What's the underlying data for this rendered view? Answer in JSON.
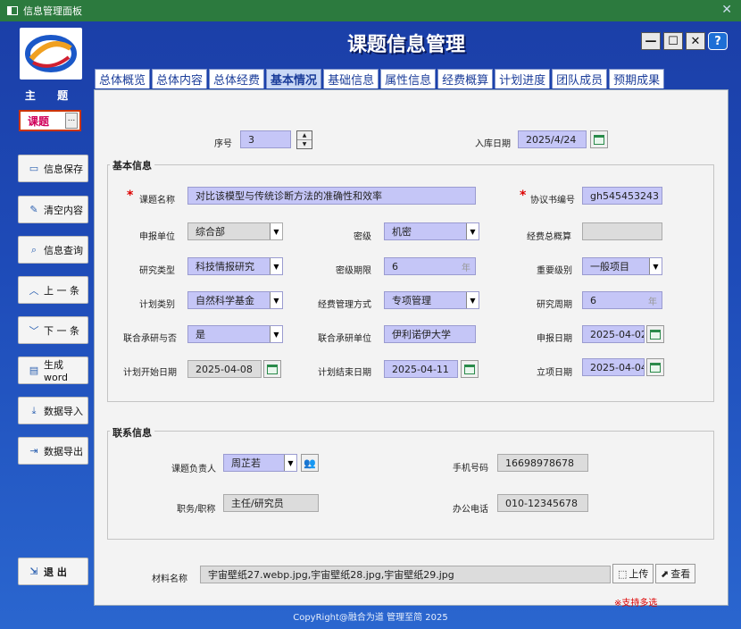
{
  "window": {
    "title": "信息管理面板"
  },
  "app": {
    "title": "课题信息管理",
    "footer": "CopyRight@融合为道 管理至简 2025"
  },
  "sidebar": {
    "theme_label": "主 题",
    "theme_value": "课题",
    "theme_more": "...",
    "buttons": [
      {
        "label": "信息保存",
        "icon": "save-icon"
      },
      {
        "label": "清空内容",
        "icon": "clear-icon"
      },
      {
        "label": "信息查询",
        "icon": "search-icon"
      },
      {
        "label": "上 一 条",
        "icon": "up-icon"
      },
      {
        "label": "下 一 条",
        "icon": "down-icon"
      },
      {
        "label": "生成word",
        "icon": "word-icon"
      },
      {
        "label": "数据导入",
        "icon": "import-icon"
      },
      {
        "label": "数据导出",
        "icon": "export-icon"
      }
    ],
    "exit_label": "退  出"
  },
  "window_controls": {
    "minimize": "—",
    "maximize": "☐",
    "close": "✕",
    "help": "?"
  },
  "tabs": [
    "总体概览",
    "总体内容",
    "总体经费",
    "基本情况",
    "基础信息",
    "属性信息",
    "经费概算",
    "计划进度",
    "团队成员",
    "预期成果"
  ],
  "active_tab": "基本情况",
  "top": {
    "seq_label": "序号",
    "seq_value": "3",
    "date_label": "入库日期",
    "date_value": "2025/4/24"
  },
  "basic": {
    "title": "基本信息",
    "topic_name_label": "课题名称",
    "topic_name": "对比该模型与传统诊断方法的准确性和效率",
    "agreement_label": "协议书编号",
    "agreement_no": "gh545453243",
    "unit_label": "申报单位",
    "unit": "综合部",
    "secret_label": "密级",
    "secret": "机密",
    "budget_label": "经费总概算",
    "budget": "",
    "research_type_label": "研究类型",
    "research_type": "科技情报研究",
    "secret_period_label": "密级期限",
    "secret_period": "6",
    "secret_period_unit": "年",
    "importance_label": "重要级别",
    "importance": "一般项目",
    "plan_type_label": "计划类别",
    "plan_type": "自然科学基金",
    "fund_mode_label": "经费管理方式",
    "fund_mode": "专项管理",
    "cycle_label": "研究周期",
    "cycle": "6",
    "cycle_unit": "年",
    "joint_label": "联合承研与否",
    "joint": "是",
    "joint_unit_label": "联合承研单位",
    "joint_unit": "伊利诺伊大学",
    "apply_date_label": "申报日期",
    "apply_date": "2025-04-02",
    "plan_start_label": "计划开始日期",
    "plan_start": "2025-04-08",
    "plan_end_label": "计划结束日期",
    "plan_end": "2025-04-11",
    "approve_date_label": "立项日期",
    "approve_date": "2025-04-04"
  },
  "contact": {
    "title": "联系信息",
    "leader_label": "课题负责人",
    "leader": "周芷若",
    "phone_label": "手机号码",
    "phone": "16698978678",
    "position_label": "职务/职称",
    "position": "主任/研究员",
    "office_label": "办公电话",
    "office": "010-12345678"
  },
  "materials": {
    "label": "材料名称",
    "value": "宇宙壁纸27.webp.jpg,宇宙壁纸28.jpg,宇宙壁纸29.jpg",
    "upload": "上传",
    "view": "查看",
    "note": "※支持多选"
  }
}
